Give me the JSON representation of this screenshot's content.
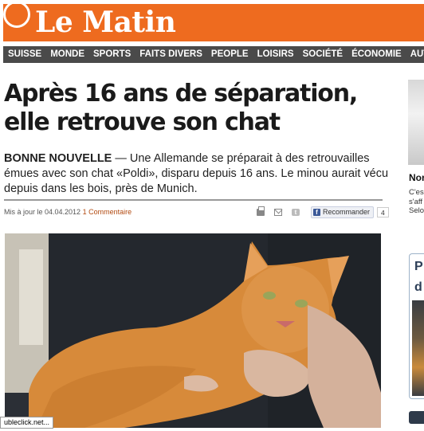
{
  "masthead": {
    "brand": "Le Matin",
    "brand_color": "#ee6b1f"
  },
  "nav": {
    "items": [
      "SUISSE",
      "MONDE",
      "SPORTS",
      "FAITS DIVERS",
      "PEOPLE",
      "LOISIRS",
      "SOCIÉTÉ",
      "ÉCONOMIE",
      "AUTO-MO"
    ]
  },
  "article": {
    "headline": "Après 16 ans de séparation, elle retrouve son chat",
    "kicker": "BONNE NOUVELLE",
    "lede": " — Une Allemande se préparait à des retrouvailles émues avec son chat «Poldi», disparu depuis 16 ans. Le minou aurait vécu depuis dans les bois, près de Munich.",
    "meta_prefix": "Mis à jour le 04.04.2012",
    "comments_link": "1 Commentaire",
    "facebook_label": "Recommander",
    "facebook_count": "4"
  },
  "status_bar": {
    "text": "ubleclick.net..."
  },
  "sidebar": {
    "title": "Nor",
    "text": "C'es\ns'aff\nSelo",
    "ad_text": "P\nd"
  },
  "icons": [
    "print-icon",
    "mail-icon",
    "twitter-icon",
    "facebook-icon"
  ]
}
